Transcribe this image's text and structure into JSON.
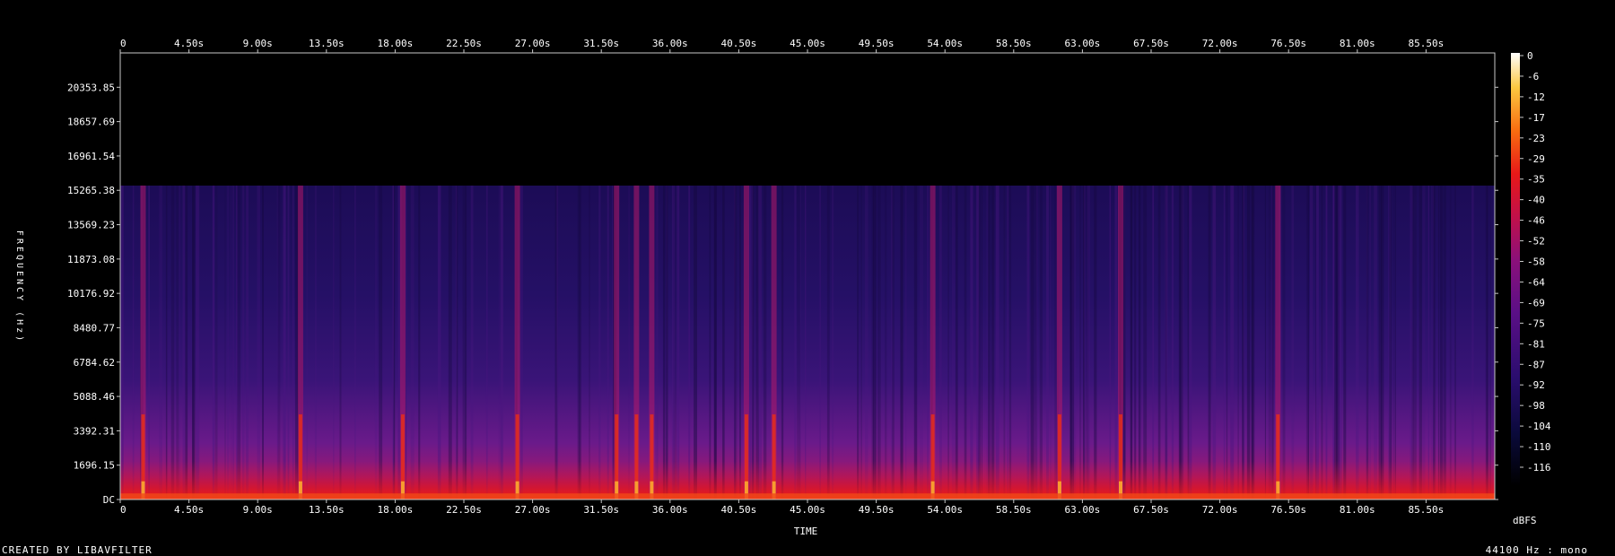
{
  "footer": {
    "created_by": "CREATED BY LIBAVFILTER",
    "format": "44100 Hz : mono"
  },
  "chart_data": {
    "type": "heatmap",
    "title": "",
    "xlabel": "TIME",
    "ylabel": "FREQUENCY (Hz)",
    "x_unit": "s",
    "x_ticks": [
      "0",
      "4.50s",
      "9.00s",
      "13.50s",
      "18.00s",
      "22.50s",
      "27.00s",
      "31.50s",
      "36.00s",
      "40.50s",
      "45.00s",
      "49.50s",
      "54.00s",
      "58.50s",
      "63.00s",
      "67.50s",
      "72.00s",
      "76.50s",
      "81.00s",
      "85.50s"
    ],
    "x_tick_values": [
      0,
      4.5,
      9.0,
      13.5,
      18.0,
      22.5,
      27.0,
      31.5,
      36.0,
      40.5,
      45.0,
      49.5,
      54.0,
      58.5,
      63.0,
      67.5,
      72.0,
      76.5,
      81.0,
      85.5
    ],
    "xlim": [
      0,
      90
    ],
    "y_ticks": [
      "DC",
      "1696.15",
      "3392.31",
      "5088.46",
      "6784.62",
      "8480.77",
      "10176.92",
      "11873.08",
      "13569.23",
      "15265.38",
      "16961.54",
      "18657.69",
      "20353.85"
    ],
    "y_tick_values": [
      0,
      1696.15,
      3392.31,
      5088.46,
      6784.62,
      8480.77,
      10176.92,
      11873.08,
      13569.23,
      15265.38,
      16961.54,
      18657.69,
      20353.85
    ],
    "ylim": [
      0,
      22050
    ],
    "cutoff_hz": 15500,
    "colorbar": {
      "label": "dBFS",
      "ticks": [
        "0",
        "-6",
        "-12",
        "-17",
        "-23",
        "-29",
        "-35",
        "-40",
        "-46",
        "-52",
        "-58",
        "-64",
        "-69",
        "-75",
        "-81",
        "-87",
        "-92",
        "-98",
        "-104",
        "-110",
        "-116"
      ],
      "range": [
        -120,
        0
      ]
    },
    "transients_s": [
      1.5,
      11.8,
      18.5,
      26.0,
      32.5,
      33.8,
      34.8,
      41.0,
      42.8,
      53.2,
      61.5,
      65.5,
      75.8
    ]
  }
}
